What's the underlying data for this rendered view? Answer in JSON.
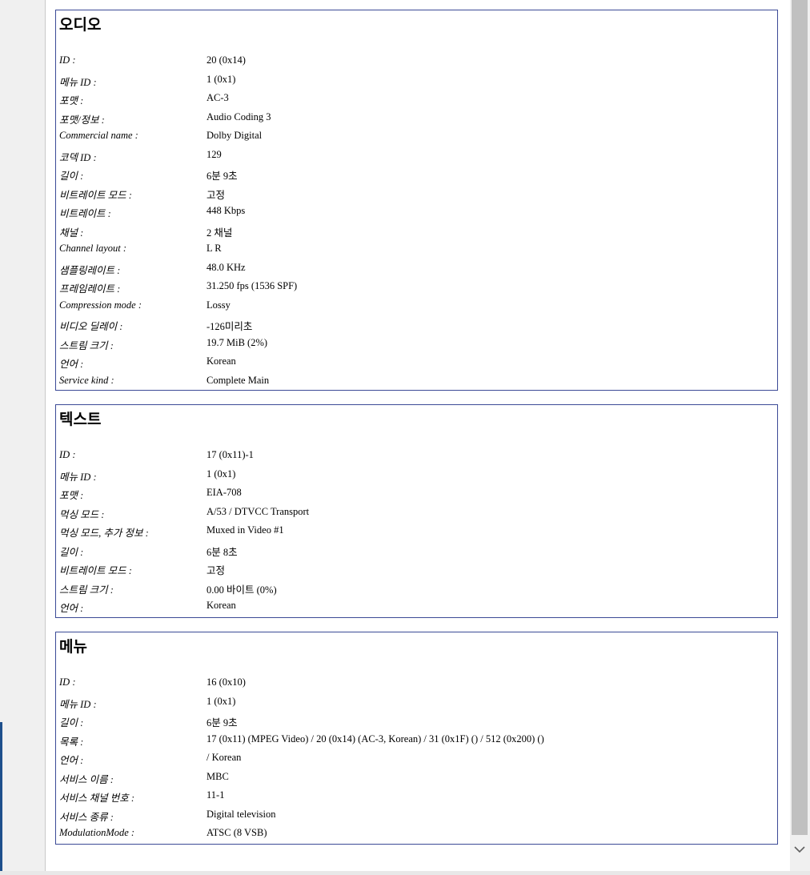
{
  "sections": [
    {
      "title": "오디오",
      "rows": [
        {
          "label": "ID :",
          "value": "20 (0x14)"
        },
        {
          "label": "메뉴 ID :",
          "value": "1 (0x1)"
        },
        {
          "label": "포맷 :",
          "value": "AC-3"
        },
        {
          "label": "포맷/정보 :",
          "value": "Audio Coding 3"
        },
        {
          "label": "Commercial name :",
          "value": "Dolby Digital"
        },
        {
          "label": "코덱 ID :",
          "value": "129"
        },
        {
          "label": "길이 :",
          "value": "6분 9초"
        },
        {
          "label": "비트레이트 모드 :",
          "value": "고정"
        },
        {
          "label": "비트레이트 :",
          "value": "448 Kbps"
        },
        {
          "label": "채널 :",
          "value": "2 채널"
        },
        {
          "label": "Channel layout :",
          "value": "L R"
        },
        {
          "label": "샘플링레이트 :",
          "value": "48.0 KHz"
        },
        {
          "label": "프레임레이트 :",
          "value": "31.250 fps (1536 SPF)"
        },
        {
          "label": "Compression mode :",
          "value": "Lossy"
        },
        {
          "label": "비디오 딜레이 :",
          "value": "-126미리초"
        },
        {
          "label": "스트림 크기 :",
          "value": "19.7 MiB (2%)"
        },
        {
          "label": "언어 :",
          "value": "Korean"
        },
        {
          "label": "Service kind :",
          "value": "Complete Main"
        }
      ]
    },
    {
      "title": "텍스트",
      "rows": [
        {
          "label": "ID :",
          "value": "17 (0x11)-1"
        },
        {
          "label": "메뉴 ID :",
          "value": "1 (0x1)"
        },
        {
          "label": "포맷 :",
          "value": "EIA-708"
        },
        {
          "label": "먹싱 모드 :",
          "value": "A/53 / DTVCC Transport"
        },
        {
          "label": "먹싱 모드, 추가 정보 :",
          "value": "Muxed in Video #1"
        },
        {
          "label": "길이 :",
          "value": "6분 8초"
        },
        {
          "label": "비트레이트 모드 :",
          "value": "고정"
        },
        {
          "label": "스트림 크기 :",
          "value": "0.00 바이트 (0%)"
        },
        {
          "label": "언어 :",
          "value": "Korean"
        }
      ]
    },
    {
      "title": "메뉴",
      "rows": [
        {
          "label": "ID :",
          "value": "16 (0x10)"
        },
        {
          "label": "메뉴 ID :",
          "value": "1 (0x1)"
        },
        {
          "label": "길이 :",
          "value": "6분 9초"
        },
        {
          "label": "목록 :",
          "value": "17 (0x11) (MPEG Video) / 20 (0x14) (AC-3, Korean) / 31 (0x1F) () / 512 (0x200) ()"
        },
        {
          "label": "언어 :",
          "value": "/ Korean"
        },
        {
          "label": "서비스 이름 :",
          "value": "MBC"
        },
        {
          "label": "서비스 채널 번호 :",
          "value": "11-1"
        },
        {
          "label": "서비스 종류 :",
          "value": "Digital television"
        },
        {
          "label": "ModulationMode :",
          "value": "ATSC (8 VSB)"
        }
      ]
    }
  ],
  "icons": {
    "scroll_down": "chevron-down-icon"
  }
}
